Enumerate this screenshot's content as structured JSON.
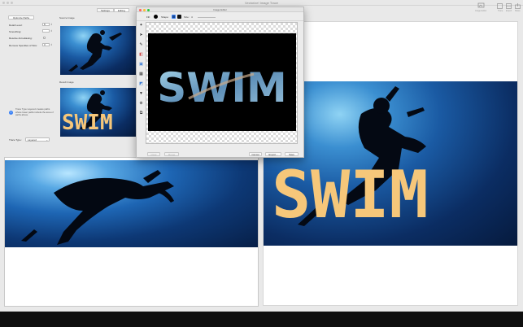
{
  "window": {
    "title": "Vectorize! Image Trace",
    "tabs": [
      {
        "label": "Settings"
      },
      {
        "label": "Editing"
      }
    ],
    "toolbar": [
      {
        "label": "Image Editor",
        "icon": "image-editor-icon"
      },
      {
        "label": "Trace",
        "icon": "trace-icon"
      },
      {
        "label": "Export",
        "icon": "export-icon"
      },
      {
        "label": "Share",
        "icon": "share-icon"
      }
    ]
  },
  "settings": {
    "optimize_label": "Optimize Paths",
    "detail_level_label": "Detail Level:",
    "detail_level_value": "8",
    "smoothing_label": "Smoothing:",
    "smoothing_value": "",
    "anti_aliasing_label": "Resolve Anti-aliasing:",
    "remove_speckles_label": "Remove Speckles of Size:",
    "remove_speckles_value": "3",
    "info_text": "Trace Type Layered creates paths where lower paths include the area of paths above.",
    "trace_type_label": "Trace Type:",
    "trace_type_value": "Layered"
  },
  "sections": {
    "source_label": "Source Image",
    "result_label": "Result Image"
  },
  "result": {
    "overlay_text": "SWIM"
  },
  "editor": {
    "title": "Image Editor",
    "fill_label": "Fill:",
    "shape_label": "Shape:",
    "size_label": "Size:",
    "size_value": "4",
    "canvas_text": "SWIM",
    "buttons": {
      "clear": "Clear",
      "merge": "Merge",
      "cancel": "Cancel",
      "export": "Export...",
      "save": "Save"
    },
    "colors": {
      "fill": "#000000",
      "shape_selected": "#1f4a8f",
      "accent": "#3b82f6"
    },
    "tools": [
      "magic-wand-icon",
      "pointer-icon",
      "pencil-icon",
      "eraser-icon",
      "image-icon",
      "mask-icon",
      "layers-icon",
      "fill-icon",
      "zoom-icon",
      "crop-icon"
    ]
  }
}
